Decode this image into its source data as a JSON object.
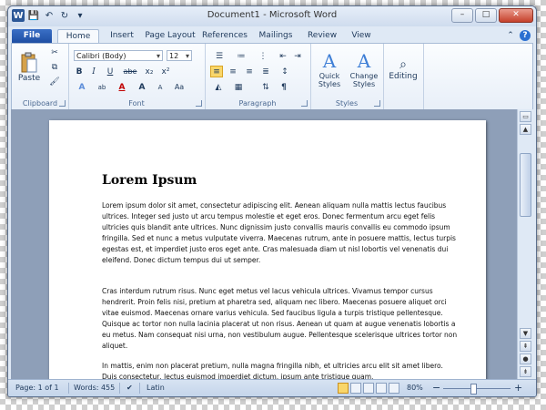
{
  "window": {
    "title": "Document1 - Microsoft Word",
    "controls": {
      "minimize": "–",
      "maximize": "□",
      "close": "✕"
    }
  },
  "qat": {
    "app_icon": "W",
    "save": "💾",
    "undo": "↶",
    "redo": "↻",
    "customize": "▾"
  },
  "tabs": [
    "File",
    "Home",
    "Insert",
    "Page Layout",
    "References",
    "Mailings",
    "Review",
    "View"
  ],
  "ribbon": {
    "clipboard": {
      "label": "Clipboard",
      "paste": "Paste"
    },
    "font": {
      "label": "Font",
      "name": "Calibri (Body)",
      "size": "12",
      "bold": "B",
      "italic": "I",
      "underline": "U",
      "strike": "abe",
      "sub": "x₂",
      "sup": "x²",
      "grow": "A",
      "shrink": "A",
      "case": "Aa",
      "color": "A",
      "highlight": "ab"
    },
    "paragraph": {
      "label": "Paragraph",
      "pilcrow": "¶"
    },
    "styles": {
      "label": "Styles",
      "quick": "Quick Styles",
      "change": "Change Styles"
    },
    "editing": {
      "label": "Editing"
    }
  },
  "document": {
    "title": "Lorem Ipsum",
    "paragraphs": [
      "Lorem ipsum dolor sit amet, consectetur adipiscing elit. Aenean aliquam nulla mattis lectus faucibus ultrices. Integer sed justo ut arcu tempus molestie et eget eros. Donec fermentum arcu eget felis ultricies quis blandit ante ultrices. Nunc dignissim justo convallis mauris convallis eu commodo ipsum fringilla. Sed et nunc a metus vulputate viverra. Maecenas rutrum, ante in posuere mattis, lectus turpis egestas est, et imperdiet justo eros eget ante. Cras malesuada diam ut nisl lobortis vel venenatis dui eleifend. Donec dictum tempus dui ut semper.",
      "Cras interdum rutrum risus. Nunc eget metus vel lacus vehicula ultrices. Vivamus tempor cursus hendrerit. Proin felis nisi, pretium at pharetra sed, aliquam nec libero. Maecenas posuere aliquet orci vitae euismod. Maecenas ornare varius vehicula. Sed faucibus ligula a turpis tristique pellentesque. Quisque ac tortor non nulla lacinia placerat ut non risus. Aenean ut quam at augue venenatis lobortis a eu metus. Nam consequat nisi urna, non vestibulum augue. Pellentesque scelerisque ultrices tortor non aliquet.",
      "In mattis, enim non placerat pretium, nulla magna fringilla nibh, et ultricies arcu elit sit amet libero. Duis consectetur, lectus euismod imperdiet dictum, ipsum ante tristique quam,"
    ]
  },
  "status": {
    "page": "Page: 1 of 1",
    "words": "Words: 455",
    "language": "Latin",
    "zoom": "80%",
    "zoom_out": "−",
    "zoom_in": "+"
  }
}
